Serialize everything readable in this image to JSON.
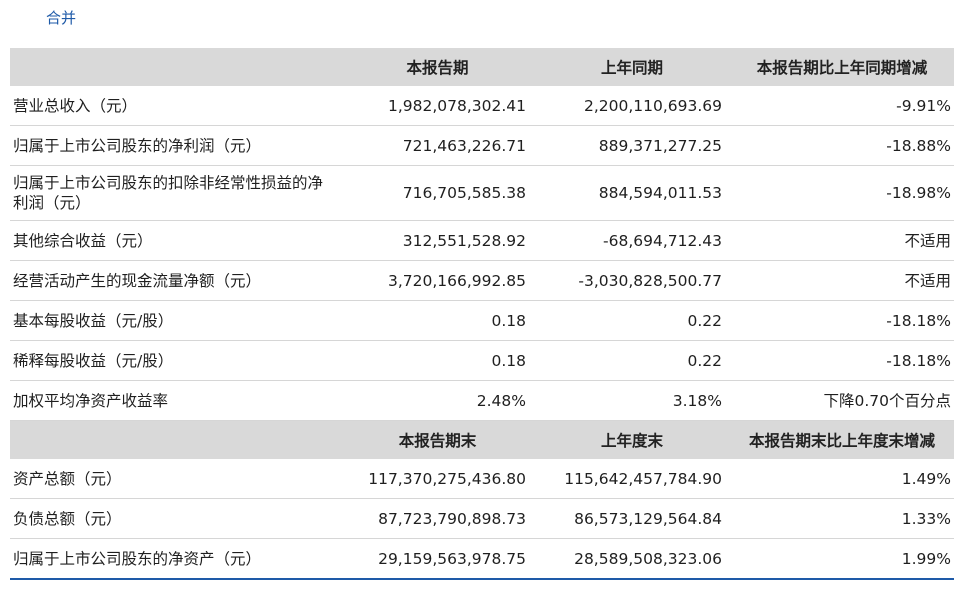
{
  "scope_label": "合并",
  "section1": {
    "headers": [
      "",
      "本报告期",
      "上年同期",
      "本报告期比上年同期增减"
    ],
    "rows": [
      [
        "营业总收入（元）",
        "1,982,078,302.41",
        "2,200,110,693.69",
        "-9.91%"
      ],
      [
        "归属于上市公司股东的净利润（元）",
        "721,463,226.71",
        "889,371,277.25",
        "-18.88%"
      ],
      [
        "归属于上市公司股东的扣除非经常性损益的净利润（元）",
        "716,705,585.38",
        "884,594,011.53",
        "-18.98%"
      ],
      [
        "其他综合收益（元）",
        "312,551,528.92",
        "-68,694,712.43",
        "不适用"
      ],
      [
        "经营活动产生的现金流量净额（元）",
        "3,720,166,992.85",
        "-3,030,828,500.77",
        "不适用"
      ],
      [
        "基本每股收益（元/股）",
        "0.18",
        "0.22",
        "-18.18%"
      ],
      [
        "稀释每股收益（元/股）",
        "0.18",
        "0.22",
        "-18.18%"
      ],
      [
        "加权平均净资产收益率",
        "2.48%",
        "3.18%",
        "下降0.70个百分点"
      ]
    ]
  },
  "section2": {
    "headers": [
      "",
      "本报告期末",
      "上年度末",
      "本报告期末比上年度末增减"
    ],
    "rows": [
      [
        "资产总额（元）",
        "117,370,275,436.80",
        "115,642,457,784.90",
        "1.49%"
      ],
      [
        "负债总额（元）",
        "87,723,790,898.73",
        "86,573,129,564.84",
        "1.33%"
      ],
      [
        "归属于上市公司股东的净资产（元）",
        "29,159,563,978.75",
        "28,589,508,323.06",
        "1.99%"
      ]
    ]
  }
}
